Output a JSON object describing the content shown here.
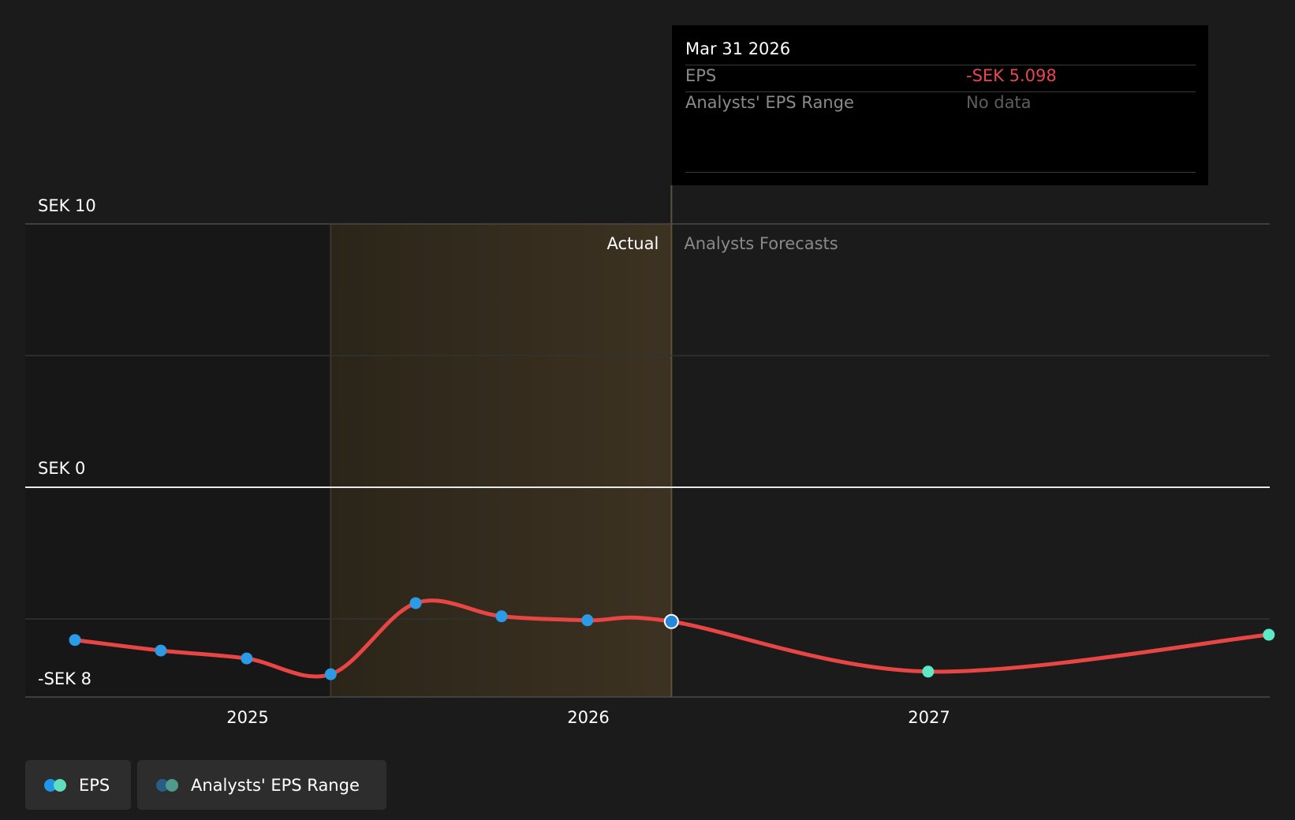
{
  "chart_data": {
    "type": "line",
    "y_axis_labels": [
      "SEK 10",
      "SEK 0",
      "-SEK 8"
    ],
    "ylim": [
      -8,
      10
    ],
    "x_ticks": [
      "2025",
      "2026",
      "2027"
    ],
    "regions": {
      "actual_label": "Actual",
      "forecast_label": "Analysts Forecasts"
    },
    "series": [
      {
        "name": "EPS",
        "points": [
          {
            "x": "2024-06-30",
            "y": -5.8,
            "kind": "actual"
          },
          {
            "x": "2024-09-30",
            "y": -6.2,
            "kind": "actual"
          },
          {
            "x": "2024-12-31",
            "y": -6.5,
            "kind": "actual"
          },
          {
            "x": "2025-03-31",
            "y": -7.1,
            "kind": "actual"
          },
          {
            "x": "2025-06-30",
            "y": -4.4,
            "kind": "actual"
          },
          {
            "x": "2025-09-30",
            "y": -4.9,
            "kind": "actual"
          },
          {
            "x": "2025-12-31",
            "y": -5.05,
            "kind": "actual"
          },
          {
            "x": "2026-03-31",
            "y": -5.098,
            "kind": "actual",
            "highlighted": true
          },
          {
            "x": "2026-12-31",
            "y": -7.0,
            "kind": "forecast"
          },
          {
            "x": "2027-12-31",
            "y": -5.6,
            "kind": "forecast"
          }
        ]
      }
    ],
    "grid": true,
    "legend_position": "bottom-left"
  },
  "tooltip": {
    "date": "Mar 31 2026",
    "rows": [
      {
        "label": "EPS",
        "value": "-SEK 5.098"
      },
      {
        "label": "Analysts' EPS Range",
        "value": "No data"
      }
    ]
  },
  "legend": [
    {
      "label": "EPS",
      "colors": [
        "#2196e8",
        "#5ee0c0"
      ]
    },
    {
      "label": "Analysts' EPS Range",
      "colors": [
        "#2a5d86",
        "#4f9b8b"
      ]
    }
  ],
  "colors": {
    "background": "#1b1b1b",
    "line": "#e84545",
    "actual_point": "#2d9ae6",
    "forecast_point": "#5ee8c5",
    "highlight_fill": "#3a2f1e",
    "negative_value": "#e8474f",
    "muted_text": "#8a8a8a"
  }
}
